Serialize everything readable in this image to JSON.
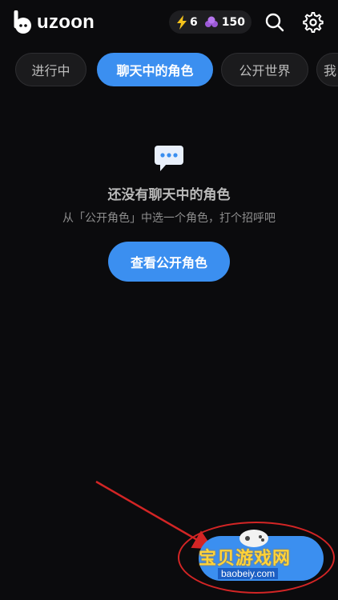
{
  "app": {
    "logo_text": "uzoon"
  },
  "header": {
    "energy_count": "6",
    "gem_count": "150",
    "energy_icon": "lightning-icon",
    "gem_icon": "gem-icon",
    "search_icon": "search-icon",
    "settings_icon": "gear-icon"
  },
  "tabs": [
    {
      "label": "进行中",
      "active": false
    },
    {
      "label": "聊天中的角色",
      "active": true
    },
    {
      "label": "公开世界",
      "active": false
    },
    {
      "label": "我",
      "active": false
    }
  ],
  "empty_state": {
    "icon": "chat-bubble-icon",
    "title": "还没有聊天中的角色",
    "subtitle": "从「公开角色」中选一个角色，打个招呼吧",
    "button_label": "查看公开角色"
  },
  "watermark": {
    "text": "宝贝游戏网",
    "url": "baobeiy.com"
  },
  "colors": {
    "accent": "#3b8ff0",
    "background": "#0b0b0d",
    "annotation_red": "#d32525"
  }
}
